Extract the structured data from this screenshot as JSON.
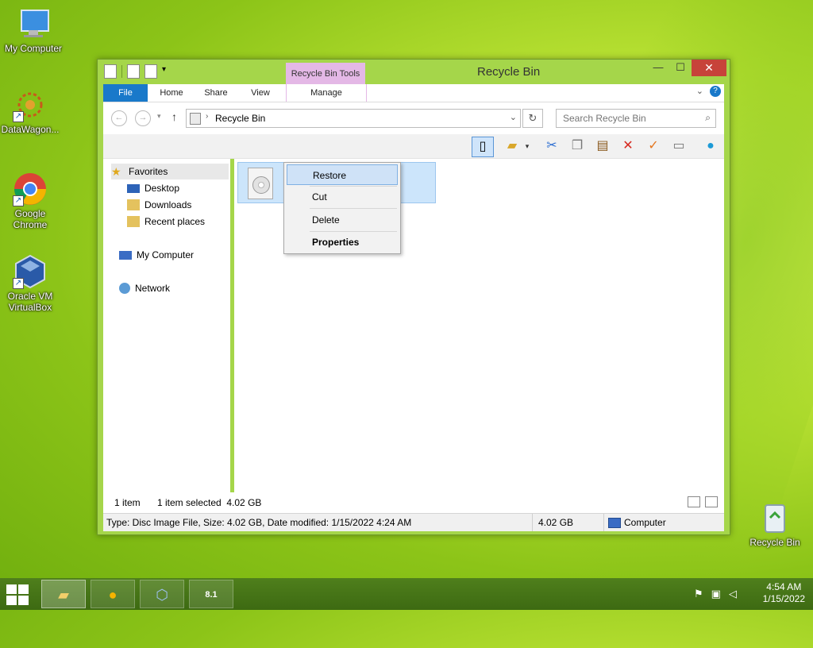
{
  "desktop": {
    "icons": [
      {
        "label": "My Computer"
      },
      {
        "label": "DataWagon..."
      },
      {
        "label": "Google Chrome"
      },
      {
        "label": "Oracle VM VirtualBox"
      },
      {
        "label": "Recycle Bin"
      }
    ]
  },
  "window": {
    "title": "Recycle Bin",
    "contextual_tab_group": "Recycle Bin Tools",
    "controls": {
      "minimize": "—",
      "maximize": "☐",
      "close": "✕"
    }
  },
  "ribbon": {
    "tabs": [
      "File",
      "Home",
      "Share",
      "View",
      "Manage"
    ],
    "help": "?"
  },
  "address_bar": {
    "path": "Recycle Bin",
    "search_placeholder": "Search Recycle Bin"
  },
  "navigation": {
    "favorites_label": "Favorites",
    "favorites": [
      "Desktop",
      "Downloads",
      "Recent places"
    ],
    "my_computer": "My Computer",
    "network": "Network"
  },
  "context_menu": {
    "items": [
      "Restore",
      "Cut",
      "Delete",
      "Properties"
    ]
  },
  "status": {
    "item_count": "1 item",
    "selection": "1 item selected  4.02 GB"
  },
  "details_bar": {
    "info": "Type: Disc Image File, Size: 4.02 GB, Date modified: 1/15/2022 4:24 AM",
    "size": "4.02 GB",
    "location": "Computer"
  },
  "taskbar": {
    "time": "4:54 AM",
    "date": "1/15/2022",
    "app_badge": "8.1"
  },
  "colors": {
    "accent": "#1979ca",
    "window_frame": "#a5d64a",
    "close": "#c7433a",
    "contextual_tab": "#e4b8e6"
  }
}
